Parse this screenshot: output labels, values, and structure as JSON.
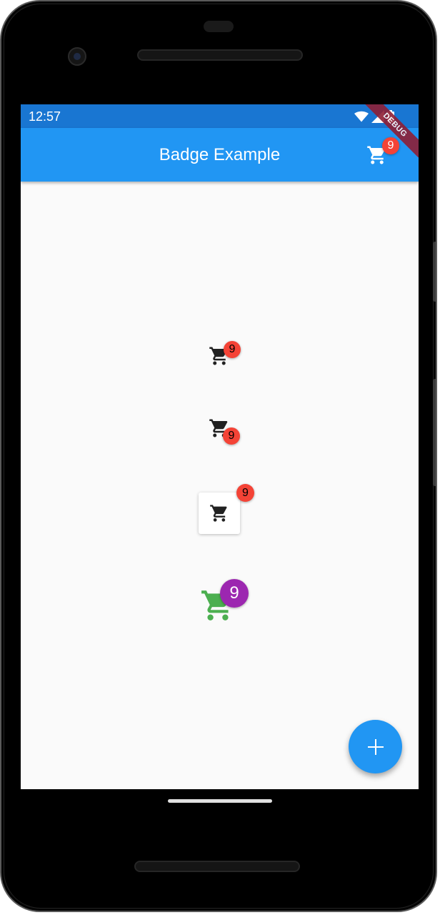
{
  "status_bar": {
    "time": "12:57"
  },
  "app_bar": {
    "title": "Badge Example",
    "cart_badge": "9"
  },
  "debug_banner": "DEBUG",
  "badges": {
    "top_right": "9",
    "bottom_right": "9",
    "card": "9",
    "large": "9"
  },
  "colors": {
    "status_bar": "#1976d2",
    "app_bar": "#2196f3",
    "badge_red": "#f44336",
    "badge_purple": "#9c27b0",
    "cart_green": "#4caf50",
    "fab": "#2196f3"
  },
  "icons": {
    "cart": "shopping-cart-icon",
    "fab": "plus-icon",
    "wifi": "wifi-icon",
    "signal": "signal-icon",
    "battery": "battery-icon"
  }
}
